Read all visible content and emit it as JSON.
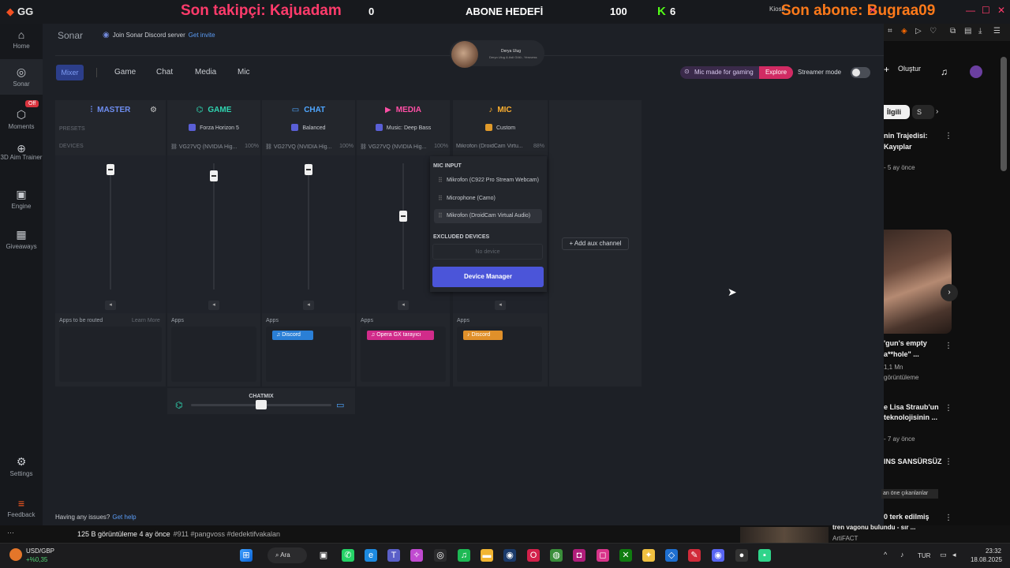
{
  "overlay": {
    "app_logo": "GG",
    "last_follower": "Son takipçi: Kajuadam",
    "counter_left": "0",
    "goal_label": "ABONE HEDEFİ",
    "counter_right": "100",
    "kick_logo": "K",
    "kick_count": "6",
    "last_sub": "Son abone: Bugraa09",
    "kiosk_text": "Kiosk"
  },
  "sidebar": {
    "items": [
      {
        "label": "Home",
        "icon": "home-icon"
      },
      {
        "label": "Sonar",
        "icon": "sonar-icon"
      },
      {
        "label": "Moments",
        "icon": "moments-icon",
        "badge": "Off"
      },
      {
        "label": "3D Aim Trainer",
        "icon": "aim-icon"
      },
      {
        "label": "Engine",
        "icon": "engine-icon"
      },
      {
        "label": "Giveaways",
        "icon": "gift-icon"
      },
      {
        "label": "Settings",
        "icon": "gear-icon"
      },
      {
        "label": "Feedback",
        "icon": "feedback-icon"
      }
    ]
  },
  "header": {
    "title": "Sonar",
    "promo_text": "Join Sonar Discord server",
    "promo_link": "Get invite",
    "streamer_name": "Derya Ulug",
    "streamer_sub": "Deryo Ulug & Asli Gölü - Yerovess"
  },
  "tabs": [
    "Mixer",
    "Game",
    "Chat",
    "Media",
    "Mic"
  ],
  "promo_right": {
    "label": "Mic made for gaming",
    "action": "Explore",
    "streamer_mode": "Streamer mode"
  },
  "channels": {
    "master": {
      "name": "MASTER",
      "presets_label": "PRESETS",
      "devices_label": "DEVICES",
      "apps_label": "Apps to be routed",
      "learn_more": "Learn More",
      "level": 0.95
    },
    "game": {
      "name": "GAME",
      "preset": "Forza Horizon 5",
      "device": "VG27VQ (NVIDIA Hig...",
      "device_pct": "100%",
      "apps_label": "Apps",
      "level": 0.9
    },
    "chat": {
      "name": "CHAT",
      "preset": "Balanced",
      "device": "VG27VQ (NVIDIA Hig...",
      "device_pct": "100%",
      "apps_label": "Apps",
      "app": "Discord",
      "level": 0.95
    },
    "media": {
      "name": "MEDIA",
      "preset": "Music: Deep Bass",
      "device": "VG27VQ (NVIDIA Hig...",
      "device_pct": "100%",
      "apps_label": "Apps",
      "app": "Opera GX tarayıcı",
      "level": 0.58
    },
    "mic": {
      "name": "MIC",
      "preset": "Custom",
      "device": "Mikrofon (DroidCam Virtu...",
      "device_pct": "88%",
      "apps_label": "Apps",
      "app": "Discord"
    }
  },
  "mic_dropdown": {
    "input_label": "MIC INPUT",
    "inputs": [
      "Mikrofon (C922 Pro Stream Webcam)",
      "Microphone (Camo)",
      "Mikrofon (DroidCam Virtual Audio)"
    ],
    "excluded_label": "EXCLUDED DEVICES",
    "no_device": "No device",
    "device_manager": "Device Manager"
  },
  "add_aux": "Add aux channel",
  "chatmix": {
    "label": "CHATMIX",
    "balance": 0.5
  },
  "help": {
    "text": "Having any issues?",
    "link": "Get help"
  },
  "youtube": {
    "create": "Oluştur",
    "chip_related": "İlgili",
    "chip_s": "S",
    "videos": [
      {
        "title1": "nin Trajedisi:",
        "title2": "Kayıplar",
        "meta": "- 5 ay önce"
      },
      {
        "title1": "'gun's empty",
        "title2": "a**hole\" ...",
        "meta1": "1,1 Mn",
        "meta2": "görüntüleme"
      },
      {
        "title1": "e Lisa Straub'un",
        "title2": "teknolojisinin ...",
        "meta": "- 7 ay önce"
      },
      {
        "title1": "INS SANSÜRSÜZ"
      },
      {
        "title1": "0 terk edilmiş",
        "title2": "tren vagonu bulundu - sır ..."
      }
    ],
    "highlight": "an öne çıkanlanlar",
    "artifact": "ArtiFACT"
  },
  "stream_strip": {
    "dots": "···",
    "views": "125 B görüntüleme  4 ay önce",
    "tags": "#911 #pangvoss #dedektifvakalan"
  },
  "taskbar": {
    "fx_name": "USD/GBP",
    "fx_val": "+%0,35",
    "search": "Ara",
    "lang": "TUR",
    "time": "23:32",
    "date": "18.08.2025"
  },
  "colors": {
    "game": "#2fd4b0",
    "chat": "#4fa6ff",
    "media": "#ff4fa6",
    "mic": "#ffb02f",
    "accent": "#4b55d9"
  }
}
